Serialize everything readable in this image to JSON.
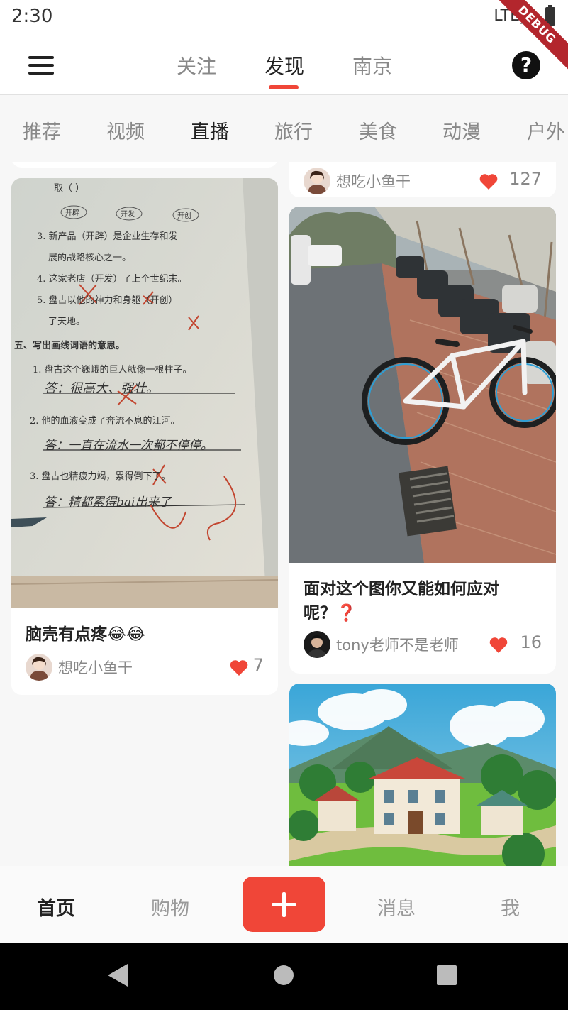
{
  "status_bar": {
    "time": "2:30",
    "network": "LTE"
  },
  "debug_label": "DEBUG",
  "top_nav": {
    "tabs": [
      "关注",
      "发现",
      "南京"
    ],
    "active_tab": "发现",
    "help": "?"
  },
  "categories": [
    "推荐",
    "视频",
    "直播",
    "旅行",
    "美食",
    "动漫",
    "户外"
  ],
  "active_category": "直播",
  "feed": {
    "top_right_partial": {
      "author": "想吃小鱼干",
      "likes": "127"
    },
    "left_card": {
      "title": "脑壳有点疼😂😂",
      "author": "想吃小鱼干",
      "likes": "7"
    },
    "right_card": {
      "title": "面对这个图你又能如何应对呢？❓",
      "author": "tony老师不是老师",
      "likes": "16"
    }
  },
  "worksheet": {
    "lines": [
      "取（        ）",
      "3. 新产品（开辟）是企业生存和发",
      "展的战略核心之一。",
      "4. 这家老店（开发）了上个世纪末。",
      "5. 盘古以他的神力和身躯（开创）",
      "了天地。",
      "五、写出画线词语的意思。",
      "1. 盘古这个巍峨的巨人就像一根柱子。",
      "答：很高大、强壮。",
      "2. 他的血液变成了奔流不息的江河。",
      "答：一直在流水一次都不停停。",
      "3. 盘古也精疲力竭，累得倒下了。",
      "答：精都累得bai出来了"
    ],
    "stamps": [
      "开辟",
      "开发",
      "开创"
    ]
  },
  "bottom_nav": {
    "items": [
      "首页",
      "购物",
      "消息",
      "我"
    ],
    "active": "首页"
  },
  "colors": {
    "accent": "#f04638",
    "text": "#222222",
    "muted": "#888888"
  }
}
